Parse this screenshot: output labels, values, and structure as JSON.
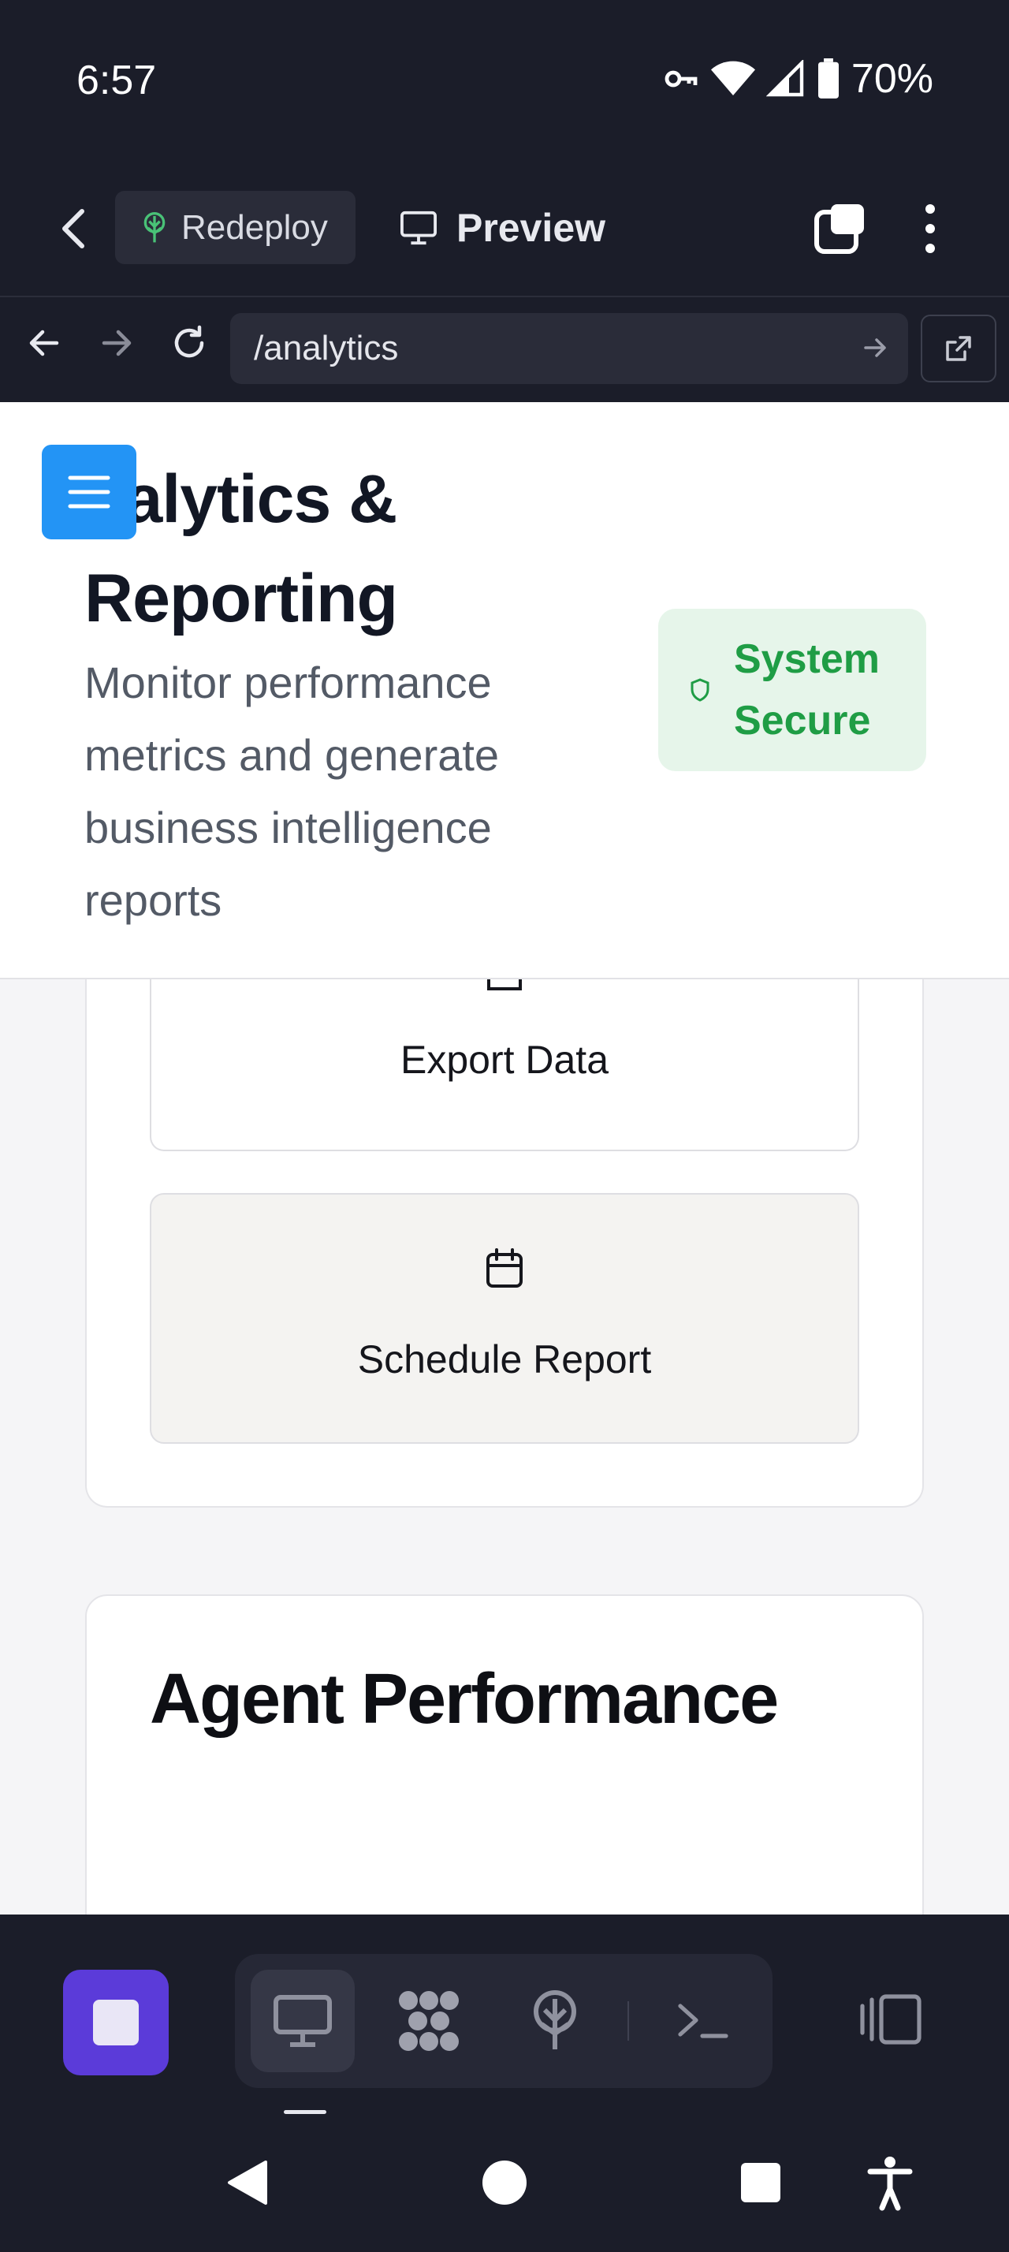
{
  "status_bar": {
    "time": "6:57",
    "battery": "70%",
    "icons": [
      "vpn-key-icon",
      "wifi-icon",
      "signal-icon",
      "battery-icon"
    ]
  },
  "app_bar": {
    "redeploy_label": "Redeploy",
    "preview_label": "Preview"
  },
  "browser": {
    "url": "/analytics"
  },
  "header": {
    "title": "nalytics & Reporting",
    "subtitle": "Monitor performance metrics and generate business intelligence reports",
    "badge": "System Secure"
  },
  "actions": {
    "export_label": "Export Data",
    "schedule_label": "Schedule Report"
  },
  "agent_card": {
    "title": "Agent Performance"
  },
  "colors": {
    "accent_blue": "#2394f5",
    "secure_green": "#1f9d45",
    "stop_purple": "#5b3bd9",
    "dark_bg": "#1b1d29"
  }
}
